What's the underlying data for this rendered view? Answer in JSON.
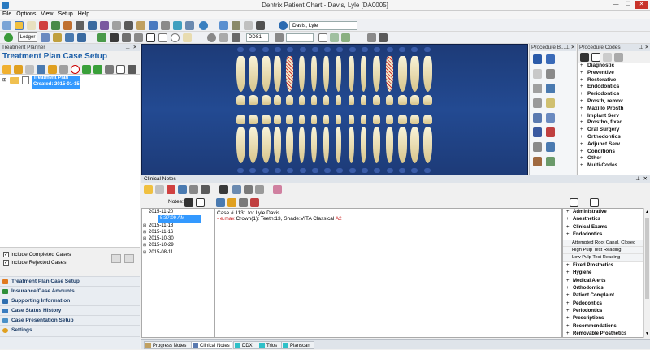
{
  "window": {
    "title": "Dentrix Patient Chart - Davis, Lyle [DA0005]"
  },
  "menu": {
    "items": [
      "File",
      "Options",
      "View",
      "Setup",
      "Help"
    ]
  },
  "toolbar": {
    "ledger_label": "Ledger",
    "patient_value": "Davis, Lyle",
    "provider_value": "DDS1"
  },
  "treatment_planner": {
    "pane_title": "Treatment Planner",
    "header": "Treatment Plan Case Setup",
    "tree_node": {
      "line1": "Treatment Plan",
      "line2": "Created: 2015-01-15"
    },
    "include_completed": "Include Completed Cases",
    "include_rejected": "Include Rejected Cases",
    "nav": [
      {
        "label": "Treatment Plan Case Setup",
        "color": "#e07a20"
      },
      {
        "label": "Insurance/Case Amounts",
        "color": "#2f8f3a"
      },
      {
        "label": "Supporting Information",
        "color": "#2f6fb0"
      },
      {
        "label": "Case Status History",
        "color": "#3a7cc0"
      },
      {
        "label": "Case Presentation Setup",
        "color": "#4a90c8"
      },
      {
        "label": "Settings",
        "color": "#e0a020"
      }
    ]
  },
  "procedure_buttons": {
    "title": "Procedure B..."
  },
  "procedure_codes": {
    "title": "Procedure Codes",
    "items": [
      "Diagnostic",
      "Preventive",
      "Restorative",
      "Endodontics",
      "Periodontics",
      "Prosth, remov",
      "Maxillo Prosth",
      "Implant Serv",
      "Prostho, fixed",
      "Oral Surgery",
      "Orthodontics",
      "Adjunct Serv",
      "Conditions",
      "Other",
      "Multi-Codes"
    ]
  },
  "clinical_notes": {
    "title": "Clinical Notes",
    "notes_label": "Notes:",
    "dates": [
      {
        "label": "2015-11-20",
        "expand": "minus"
      },
      {
        "label": "5:37:09 AM [DDS1]",
        "selected": true
      },
      {
        "label": "2015-11-18",
        "expand": "plus"
      },
      {
        "label": "2015-11-16",
        "expand": "plus"
      },
      {
        "label": "2015-10-30",
        "expand": "plus"
      },
      {
        "label": "2015-10-29",
        "expand": "plus"
      },
      {
        "label": "2015-08-11",
        "expand": "plus"
      }
    ],
    "note_line1": "Case # 1131 for Lyle Davis",
    "note_line2_prefix": "- e.max",
    "note_line2_main": " Crown(1): Teeth:13, Shade:VITA Classical ",
    "note_line2_shade": "A2",
    "categories": [
      {
        "label": "Administrative",
        "type": "cat"
      },
      {
        "label": "Anesthetics",
        "type": "cat"
      },
      {
        "label": "Clinical Exams",
        "type": "cat"
      },
      {
        "label": "Endodontics",
        "type": "cat"
      },
      {
        "label": "Attempted Root Canal, Closed",
        "type": "sub"
      },
      {
        "label": "High Pulp Test Reading",
        "type": "sub"
      },
      {
        "label": "Low Pulp Test Reading",
        "type": "sub"
      },
      {
        "label": "Fixed Prosthetics",
        "type": "cat"
      },
      {
        "label": "Hygiene",
        "type": "cat"
      },
      {
        "label": "Medical Alerts",
        "type": "cat"
      },
      {
        "label": "Orthodontics",
        "type": "cat"
      },
      {
        "label": "Patient Complaint",
        "type": "cat"
      },
      {
        "label": "Pedodontics",
        "type": "cat"
      },
      {
        "label": "Periodontics",
        "type": "cat"
      },
      {
        "label": "Prescriptions",
        "type": "cat"
      },
      {
        "label": "Recommendations",
        "type": "cat"
      },
      {
        "label": "Removable Prosthetics",
        "type": "cat"
      }
    ],
    "tabs": [
      "Progress Notes",
      "Clinical Notes",
      "DDX",
      "Trios",
      "Planscan"
    ]
  },
  "colors": {
    "accent_blue": "#1d5fa8",
    "chart_bg": "#234a92",
    "selection": "#3399ff",
    "note_red": "#cc2020"
  }
}
